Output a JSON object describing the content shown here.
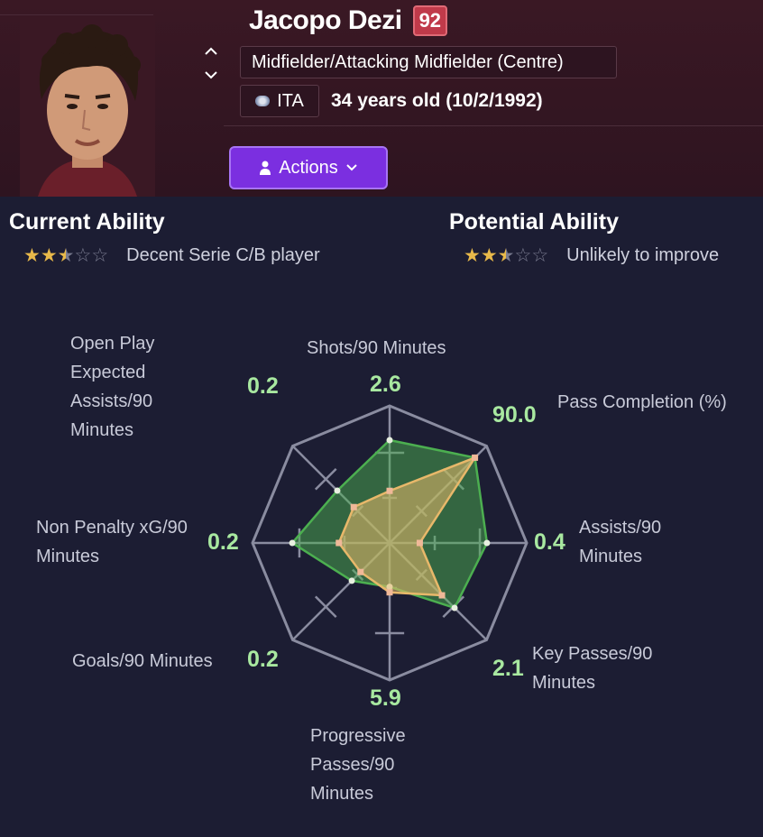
{
  "player": {
    "name": "Jacopo Dezi",
    "rating": "92",
    "position": "Midfielder/Attacking Midfielder (Centre)",
    "nation": "ITA",
    "age": "34 years old (10/2/1992)",
    "actions_label": "Actions"
  },
  "current_ability": {
    "title": "Current Ability",
    "stars": 2.5,
    "max_stars": 5,
    "description": "Decent Serie C/B player"
  },
  "potential_ability": {
    "title": "Potential Ability",
    "stars": 2.5,
    "max_stars": 5,
    "description": "Unlikely to improve"
  },
  "icons": {
    "nav_up": "chevron-up-icon",
    "nav_down": "chevron-down-icon",
    "nation_flag": "flag-icon",
    "actions_person": "person-icon",
    "actions_chevron": "chevron-down-icon"
  },
  "colors": {
    "header_bg": "#3a1824",
    "page_bg": "#1c1d33",
    "rating_badge": "#c03a4a",
    "actions_button": "#7b2fe0",
    "value_text": "#a8e8a0",
    "player_area": "#4caf50",
    "comparison_area": "#e8b86a"
  },
  "chart_data": {
    "type": "radar",
    "metrics": [
      {
        "label": "Shots/90 Minutes",
        "value": "2.6"
      },
      {
        "label": "Pass Completion (%)",
        "value": "90.0"
      },
      {
        "label": "Assists/90 Minutes",
        "value": "0.4"
      },
      {
        "label": "Key Passes/90 Minutes",
        "value": "2.1"
      },
      {
        "label": "Progressive Passes/90 Minutes",
        "value": "5.9"
      },
      {
        "label": "Goals/90 Minutes",
        "value": "0.2"
      },
      {
        "label": "Non Penalty xG/90 Minutes",
        "value": "0.2"
      },
      {
        "label": "Open Play Expected Assists/90 Minutes",
        "value": "0.2"
      }
    ],
    "series": [
      {
        "role": "player",
        "color": "#4caf50",
        "values": [
          0.75,
          0.88,
          0.71,
          0.67,
          0.32,
          0.39,
          0.71,
          0.54
        ]
      },
      {
        "role": "comparison",
        "color": "#e8b86a",
        "values": [
          0.38,
          0.88,
          0.22,
          0.54,
          0.36,
          0.3,
          0.37,
          0.37
        ]
      }
    ],
    "rings": 3
  }
}
